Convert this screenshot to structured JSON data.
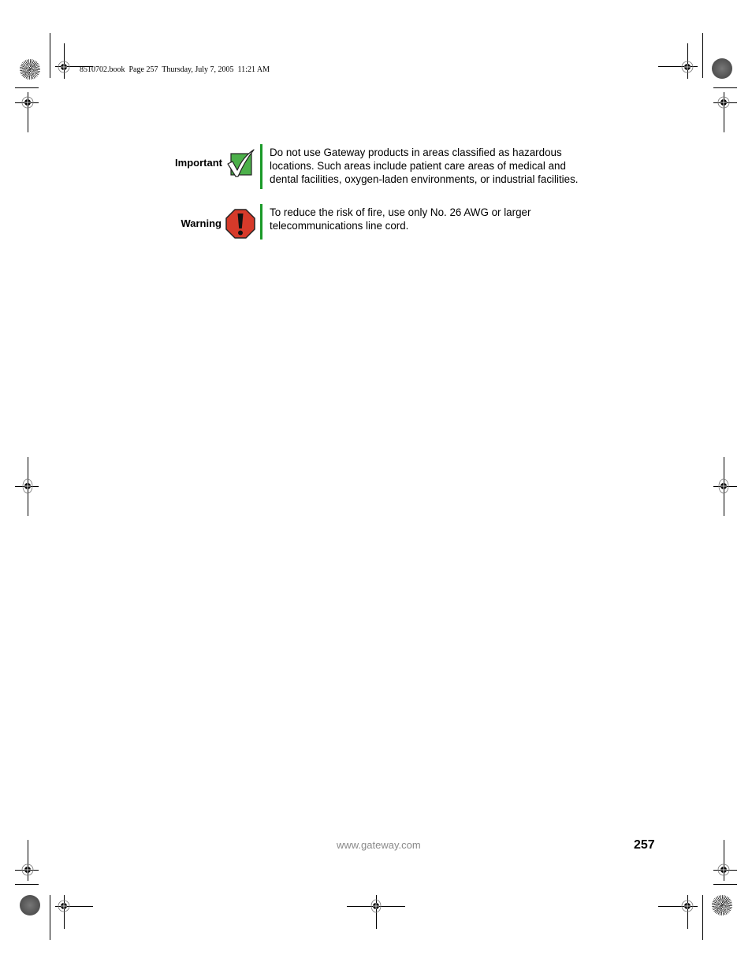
{
  "header": {
    "slug": "8510702.book  Page 257  Thursday, July 7, 2005  11:21 AM"
  },
  "notices": [
    {
      "type": "important",
      "label": "Important",
      "icon": "checkmark-icon",
      "text": "Do not use Gateway products in areas classified as hazardous locations. Such areas include patient care areas of medical and dental facilities, oxygen-laden environments, or industrial facilities.",
      "lines": [
        "Do not use Gateway products in areas classified as hazardous",
        "locations. Such areas include patient care areas of medical and",
        "dental facilities, oxygen-laden environments, or industrial facilities."
      ]
    },
    {
      "type": "warning",
      "label": "Warning",
      "icon": "exclamation-stop-icon",
      "text": "To reduce the risk of fire, use only No. 26 AWG or larger telecommunications line cord.",
      "lines": [
        "To reduce the risk of fire, use only No. 26 AWG or larger",
        "telecommunications line cord."
      ]
    }
  ],
  "footer": {
    "url": "www.gateway.com",
    "page_number": "257"
  },
  "colors": {
    "accent_bar": "#1a9a28",
    "important_icon": "#4cb04a",
    "warning_icon": "#d63a2a",
    "footer_url": "#8a8a8a"
  }
}
